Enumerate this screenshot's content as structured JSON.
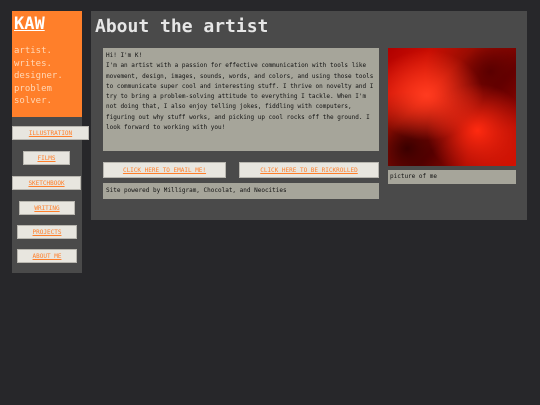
{
  "sidebar": {
    "logo": "KAW",
    "tagline": "artist.\nwrites.\ndesigner.\nproblem\nsolver.",
    "nav": [
      {
        "label": "ILLUSTRATION"
      },
      {
        "label": "FILMS"
      },
      {
        "label": "SKETCHBOOK"
      },
      {
        "label": "WRITING"
      },
      {
        "label": "PROJECTS"
      },
      {
        "label": "ABOUT ME"
      }
    ]
  },
  "main": {
    "title": "About the artist",
    "bio": {
      "greeting": "Hi! I'm K!",
      "body": "I'm an artist with a passion for effective communication with tools like movement, design, images, sounds, words, and colors, and using those tools to communicate super cool and interesting stuff. I thrive on novelty and I try to bring a problem-solving attitude to everything I tackle. When I'm not doing that, I also enjoy telling jokes, fiddling with computers, figuring out why stuff works, and picking up cool rocks off the ground. I look forward to working with you!"
    },
    "photo_caption": "picture of me",
    "email_button": "CLICK HERE TO EMAIL ME!",
    "rickroll_button": "CLICK HERE TO BE RICKROLLED",
    "footer": "Site powered by Milligram, Chocolat, and Neocities"
  },
  "colors": {
    "background": "#27272a",
    "panel": "#4a4a4a",
    "accent": "#ff7f2a",
    "card": "#a6a59a",
    "button": "#e8e6df"
  }
}
